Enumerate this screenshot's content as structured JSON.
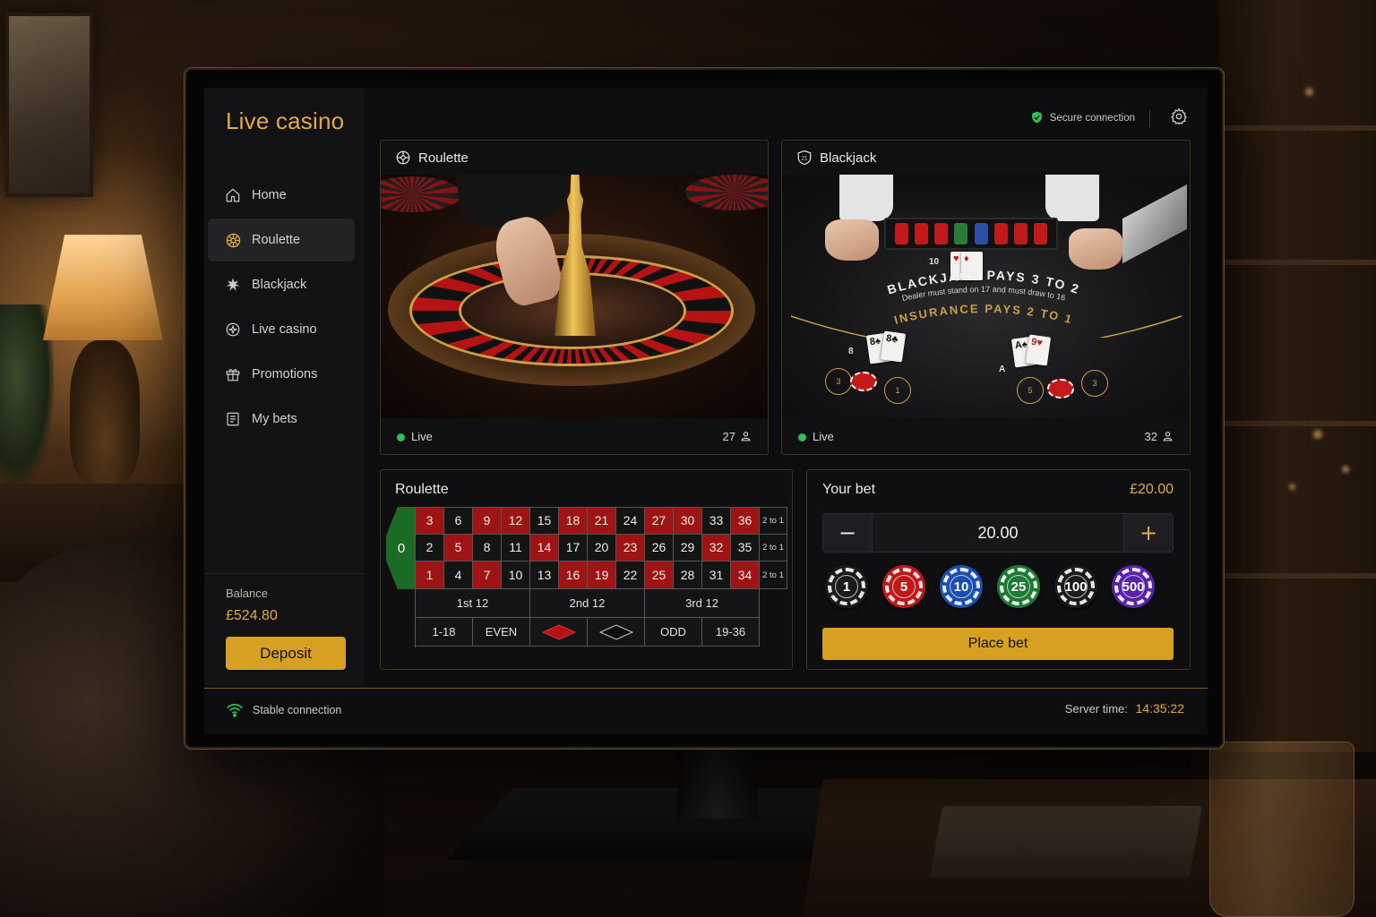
{
  "app": {
    "title": "Live casino"
  },
  "sidebar": {
    "items": [
      {
        "label": "Home",
        "icon": "home-icon"
      },
      {
        "label": "Roulette",
        "icon": "roulette-icon",
        "active": true
      },
      {
        "label": "Blackjack",
        "icon": "spade-icon"
      },
      {
        "label": "Live casino",
        "icon": "live-casino-icon"
      },
      {
        "label": "Promotions",
        "icon": "gift-icon"
      },
      {
        "label": "My bets",
        "icon": "receipt-icon"
      }
    ],
    "balance_label": "Balance",
    "balance_value": "£524.80",
    "deposit_label": "Deposit"
  },
  "topbar": {
    "secure_label": "Secure connection",
    "secure_icon": "shield-check-icon",
    "settings_icon": "gear-icon"
  },
  "tables": [
    {
      "name": "Roulette",
      "status": "Live",
      "viewers": "27",
      "icon": "roulette-icon"
    },
    {
      "name": "Blackjack",
      "status": "Live",
      "viewers": "32",
      "icon": "cards-icon"
    }
  ],
  "blackjack_felt": {
    "line1": "BLACKJACK PAYS 3 TO 2",
    "line2": "Dealer must stand on 17 and must draw to 16",
    "line3": "INSURANCE PAYS 2 TO 1",
    "dealer_total": "10",
    "player1_total": "8",
    "player2_total": "A"
  },
  "board": {
    "title": "Roulette",
    "zero": "0",
    "rows": [
      [
        "3",
        "6",
        "9",
        "12",
        "15",
        "18",
        "21",
        "24",
        "27",
        "30",
        "33",
        "36",
        "2 to 1"
      ],
      [
        "2",
        "5",
        "8",
        "11",
        "14",
        "17",
        "20",
        "23",
        "26",
        "29",
        "32",
        "35",
        "2 to 1"
      ],
      [
        "1",
        "4",
        "7",
        "10",
        "13",
        "16",
        "19",
        "22",
        "25",
        "28",
        "31",
        "34",
        "2 to 1"
      ]
    ],
    "red_numbers": [
      "1",
      "3",
      "5",
      "7",
      "9",
      "12",
      "14",
      "16",
      "18",
      "19",
      "21",
      "23",
      "25",
      "27",
      "30",
      "32",
      "34",
      "36"
    ],
    "dozens": [
      "1st 12",
      "2nd 12",
      "3rd 12"
    ],
    "outside": [
      "1-18",
      "EVEN",
      "RED",
      "BLACK",
      "ODD",
      "19-36"
    ]
  },
  "bet": {
    "title": "Your bet",
    "total": "£20.00",
    "value": "20.00",
    "minus": "−",
    "plus": "+",
    "chips": [
      {
        "value": "1",
        "color": "#1b1b1b"
      },
      {
        "value": "5",
        "color": "#c01818"
      },
      {
        "value": "10",
        "color": "#1a4fb0"
      },
      {
        "value": "25",
        "color": "#1c7a32"
      },
      {
        "value": "100",
        "color": "#1b1b1b"
      },
      {
        "value": "500",
        "color": "#5a22a8"
      }
    ],
    "place_label": "Place bet"
  },
  "status": {
    "connection": "Stable connection",
    "server_label": "Server time:",
    "server_time": "14:35:22"
  },
  "colors": {
    "accent": "#e3aa45",
    "button": "#d7a022",
    "live": "#2fbf55",
    "red": "#9e1414",
    "green": "#1a6b24"
  }
}
